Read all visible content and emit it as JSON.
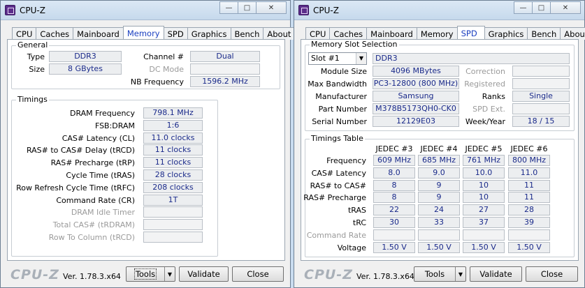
{
  "app_title": "CPU-Z",
  "logo": "CPU-Z",
  "version": "Ver. 1.78.3.x64",
  "buttons": {
    "tools": "Tools",
    "validate": "Validate",
    "close": "Close"
  },
  "window_controls": {
    "minimize": "—",
    "maximize": "□",
    "close": "✕"
  },
  "left": {
    "tabs": [
      "CPU",
      "Caches",
      "Mainboard",
      "Memory",
      "SPD",
      "Graphics",
      "Bench",
      "About"
    ],
    "active_tab": "Memory",
    "general": {
      "group_label": "General",
      "type_label": "Type",
      "type_value": "DDR3",
      "size_label": "Size",
      "size_value": "8 GBytes",
      "channel_label": "Channel #",
      "channel_value": "Dual",
      "dc_mode_label": "DC Mode",
      "dc_mode_value": "",
      "nb_freq_label": "NB Frequency",
      "nb_freq_value": "1596.2 MHz"
    },
    "timings": {
      "group_label": "Timings",
      "rows": [
        {
          "label": "DRAM Frequency",
          "value": "798.1 MHz",
          "enabled": true
        },
        {
          "label": "FSB:DRAM",
          "value": "1:6",
          "enabled": true
        },
        {
          "label": "CAS# Latency (CL)",
          "value": "11.0 clocks",
          "enabled": true
        },
        {
          "label": "RAS# to CAS# Delay (tRCD)",
          "value": "11 clocks",
          "enabled": true
        },
        {
          "label": "RAS# Precharge (tRP)",
          "value": "11 clocks",
          "enabled": true
        },
        {
          "label": "Cycle Time (tRAS)",
          "value": "28 clocks",
          "enabled": true
        },
        {
          "label": "Row Refresh Cycle Time (tRFC)",
          "value": "208 clocks",
          "enabled": true
        },
        {
          "label": "Command Rate (CR)",
          "value": "1T",
          "enabled": true
        },
        {
          "label": "DRAM Idle Timer",
          "value": "",
          "enabled": false
        },
        {
          "label": "Total CAS# (tRDRAM)",
          "value": "",
          "enabled": false
        },
        {
          "label": "Row To Column (tRCD)",
          "value": "",
          "enabled": false
        }
      ]
    }
  },
  "right": {
    "tabs": [
      "CPU",
      "Caches",
      "Mainboard",
      "Memory",
      "Graphics",
      "Bench",
      "About"
    ],
    "active_tab": "SPD",
    "slot": {
      "group_label": "Memory Slot Selection",
      "selected": "Slot #1",
      "type_value": "DDR3",
      "module_size_label": "Module Size",
      "module_size_value": "4096 MBytes",
      "max_bw_label": "Max Bandwidth",
      "max_bw_value": "PC3-12800 (800 MHz)",
      "manufacturer_label": "Manufacturer",
      "manufacturer_value": "Samsung",
      "part_label": "Part Number",
      "part_value": "M378B5173QH0-CK0",
      "serial_label": "Serial Number",
      "serial_value": "12129E03",
      "correction_label": "Correction",
      "correction_value": "",
      "registered_label": "Registered",
      "registered_value": "",
      "ranks_label": "Ranks",
      "ranks_value": "Single",
      "spd_ext_label": "SPD Ext.",
      "spd_ext_value": "",
      "week_year_label": "Week/Year",
      "week_year_value": "18 / 15"
    },
    "timings_table": {
      "group_label": "Timings Table",
      "columns": [
        "JEDEC #3",
        "JEDEC #4",
        "JEDEC #5",
        "JEDEC #6"
      ],
      "rows": [
        {
          "label": "Frequency",
          "enabled": true,
          "values": [
            "609 MHz",
            "685 MHz",
            "761 MHz",
            "800 MHz"
          ]
        },
        {
          "label": "CAS# Latency",
          "enabled": true,
          "values": [
            "8.0",
            "9.0",
            "10.0",
            "11.0"
          ]
        },
        {
          "label": "RAS# to CAS#",
          "enabled": true,
          "values": [
            "8",
            "9",
            "10",
            "11"
          ]
        },
        {
          "label": "RAS# Precharge",
          "enabled": true,
          "values": [
            "8",
            "9",
            "10",
            "11"
          ]
        },
        {
          "label": "tRAS",
          "enabled": true,
          "values": [
            "22",
            "24",
            "27",
            "28"
          ]
        },
        {
          "label": "tRC",
          "enabled": true,
          "values": [
            "30",
            "33",
            "37",
            "39"
          ]
        },
        {
          "label": "Command Rate",
          "enabled": false,
          "values": [
            "",
            "",
            "",
            ""
          ]
        },
        {
          "label": "Voltage",
          "enabled": true,
          "values": [
            "1.50 V",
            "1.50 V",
            "1.50 V",
            "1.50 V"
          ]
        }
      ]
    }
  }
}
